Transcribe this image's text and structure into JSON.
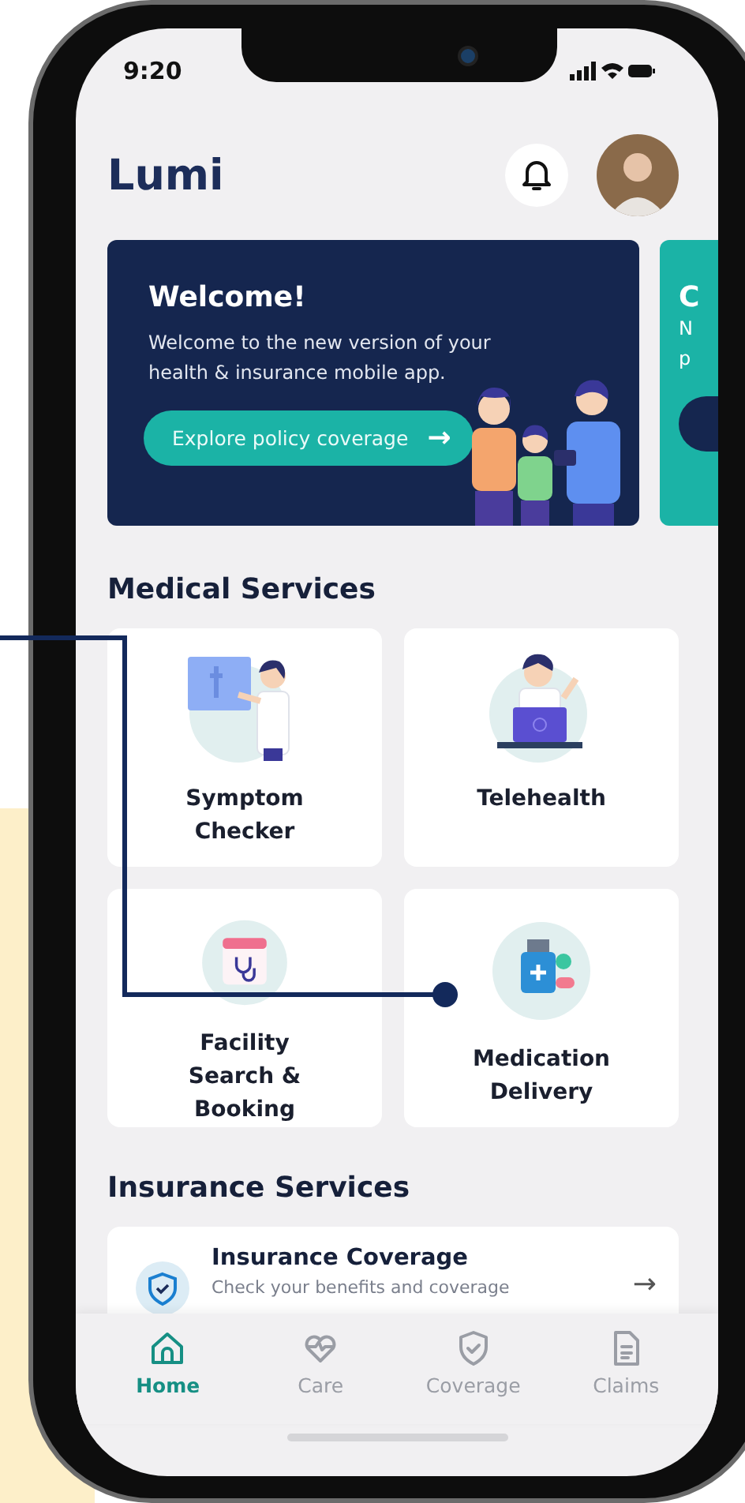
{
  "status_bar": {
    "time": "9:20"
  },
  "header": {
    "title": "Lumi"
  },
  "banner": {
    "title": "Welcome!",
    "text": "Welcome to the new version of your health & insurance mobile app.",
    "button": "Explore policy coverage",
    "arrow": "→"
  },
  "peek_card": {
    "title": "C",
    "lines": [
      "N",
      "p"
    ]
  },
  "medical_services": {
    "title": "Medical Services",
    "items": [
      {
        "label": "Symptom Checker",
        "kind": "chart"
      },
      {
        "label": "Telehealth",
        "kind": "laptop"
      },
      {
        "label": "Facility Search & Booking",
        "kind": "calendar"
      },
      {
        "label": "Medication Delivery",
        "kind": "medicine"
      }
    ]
  },
  "insurance_services": {
    "title": "Insurance Services",
    "items": [
      {
        "title": "Insurance Coverage",
        "subtitle": "Check your benefits and coverage",
        "arrow": "→"
      }
    ]
  },
  "nav": [
    {
      "label": "Home",
      "kind": "home",
      "selected": true
    },
    {
      "label": "Care",
      "kind": "care",
      "selected": false
    },
    {
      "label": "Coverage",
      "kind": "shield",
      "selected": false
    },
    {
      "label": "Claims",
      "kind": "doc",
      "selected": false
    }
  ]
}
